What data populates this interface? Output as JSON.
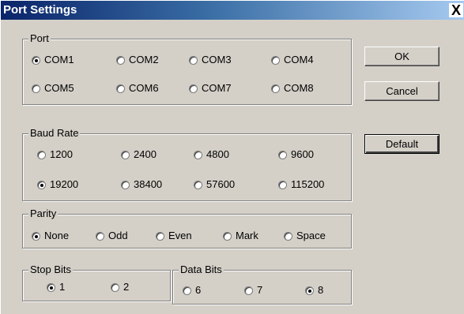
{
  "window": {
    "title": "Port Settings",
    "close_glyph": "X"
  },
  "port": {
    "legend": "Port",
    "options": [
      {
        "label": "COM1",
        "selected": true
      },
      {
        "label": "COM2",
        "selected": false
      },
      {
        "label": "COM3",
        "selected": false
      },
      {
        "label": "COM4",
        "selected": false
      },
      {
        "label": "COM5",
        "selected": false
      },
      {
        "label": "COM6",
        "selected": false
      },
      {
        "label": "COM7",
        "selected": false
      },
      {
        "label": "COM8",
        "selected": false
      }
    ]
  },
  "baud": {
    "legend": "Baud Rate",
    "options": [
      {
        "label": "1200",
        "selected": false
      },
      {
        "label": "2400",
        "selected": false
      },
      {
        "label": "4800",
        "selected": false
      },
      {
        "label": "9600",
        "selected": false
      },
      {
        "label": "19200",
        "selected": true
      },
      {
        "label": "38400",
        "selected": false
      },
      {
        "label": "57600",
        "selected": false
      },
      {
        "label": "115200",
        "selected": false
      }
    ]
  },
  "parity": {
    "legend": "Parity",
    "options": [
      {
        "label": "None",
        "selected": true
      },
      {
        "label": "Odd",
        "selected": false
      },
      {
        "label": "Even",
        "selected": false
      },
      {
        "label": "Mark",
        "selected": false
      },
      {
        "label": "Space",
        "selected": false
      }
    ]
  },
  "stop_bits": {
    "legend": "Stop Bits",
    "options": [
      {
        "label": "1",
        "selected": true
      },
      {
        "label": "2",
        "selected": false
      }
    ]
  },
  "data_bits": {
    "legend": "Data Bits",
    "options": [
      {
        "label": "6",
        "selected": false
      },
      {
        "label": "7",
        "selected": false
      },
      {
        "label": "8",
        "selected": true
      }
    ]
  },
  "buttons": {
    "ok": "OK",
    "cancel": "Cancel",
    "default": "Default"
  }
}
